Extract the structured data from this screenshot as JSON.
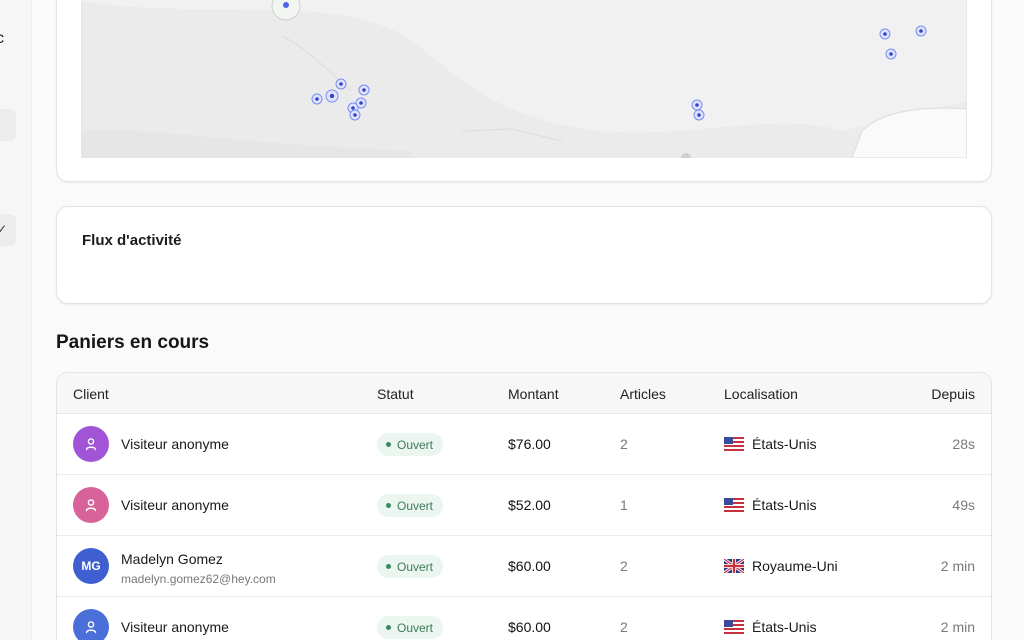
{
  "sidebar": {
    "glyph_top": "c",
    "check_icon": "check-icon"
  },
  "map": {
    "name": "visitor-map"
  },
  "activity": {
    "title": "Flux d'activité"
  },
  "carts": {
    "section_title": "Paniers en cours",
    "columns": {
      "client": "Client",
      "status": "Statut",
      "amount": "Montant",
      "articles": "Articles",
      "location": "Localisation",
      "since": "Depuis"
    },
    "rows": [
      {
        "name": "Visiteur anonyme",
        "email": "",
        "avatar_initials": "",
        "avatar_icon": "user-icon",
        "avatar_color": "#a155d6",
        "status": "Ouvert",
        "amount": "$76.00",
        "articles": "2",
        "flag": "us-flag-icon",
        "location": "États-Unis",
        "since": "28s"
      },
      {
        "name": "Visiteur anonyme",
        "email": "",
        "avatar_initials": "",
        "avatar_icon": "user-icon",
        "avatar_color": "#d8639a",
        "status": "Ouvert",
        "amount": "$52.00",
        "articles": "1",
        "flag": "us-flag-icon",
        "location": "États-Unis",
        "since": "49s"
      },
      {
        "name": "Madelyn Gomez",
        "email": "madelyn.gomez62@hey.com",
        "avatar_initials": "MG",
        "avatar_icon": "",
        "avatar_color": "#3f5ed0",
        "status": "Ouvert",
        "amount": "$60.00",
        "articles": "2",
        "flag": "uk-flag-icon",
        "location": "Royaume-Uni",
        "since": "2 min"
      },
      {
        "name": "Visiteur anonyme",
        "email": "",
        "avatar_initials": "",
        "avatar_icon": "user-icon",
        "avatar_color": "#4a6fd8",
        "status": "Ouvert",
        "amount": "$60.00",
        "articles": "2",
        "flag": "us-flag-icon",
        "location": "États-Unis",
        "since": "2 min"
      }
    ]
  },
  "colors": {
    "accent_dot": "#4d63e8",
    "status_bg": "#ecf6f0",
    "status_text": "#3b7a57"
  }
}
